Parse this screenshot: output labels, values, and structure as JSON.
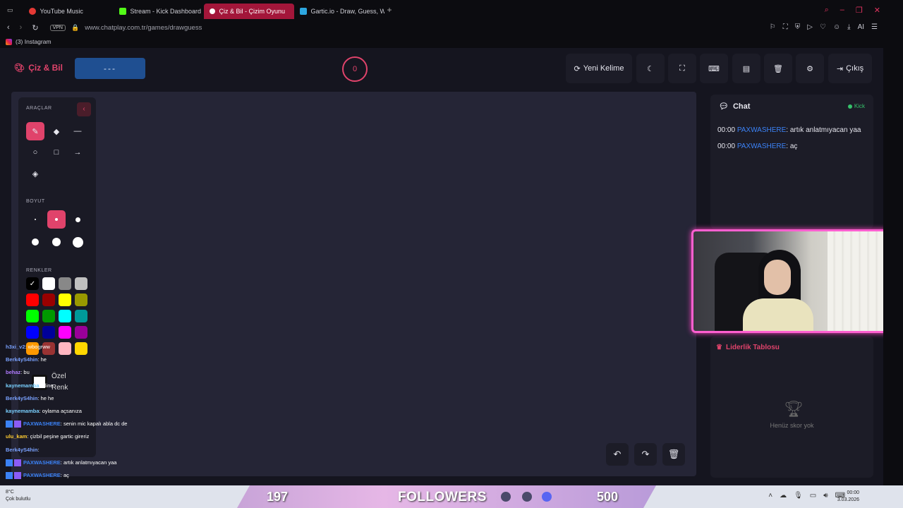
{
  "browser": {
    "tabs": [
      {
        "label": "YouTube Music",
        "color": "#e53935"
      },
      {
        "label": "Stream - Kick Dashboard",
        "color": "#53fc18"
      },
      {
        "label": "Çiz & Bil - Çizim Oyunu",
        "color": "#e0436b"
      },
      {
        "label": "Gartic.io - Draw, Guess, W",
        "color": "#2da7e0"
      }
    ],
    "url": "www.chatplay.com.tr/games/drawguess",
    "vpn": "VPN",
    "bookmark": "(3) Instagram"
  },
  "header": {
    "logo": "Çiz & Bil",
    "word": "---",
    "timer": "0",
    "new_word": "Yeni Kelime",
    "exit": "Çıkış"
  },
  "tools": {
    "title": "ARAÇLAR",
    "size_title": "BOYUT",
    "colors_title": "RENKLER",
    "custom_label": "Özel Renk",
    "swatches": [
      "#000000",
      "#ffffff",
      "#888888",
      "#c0c0c0",
      "#ff0000",
      "#990000",
      "#ffff00",
      "#999900",
      "#00ff00",
      "#009900",
      "#00ffff",
      "#009999",
      "#0000ff",
      "#000099",
      "#ff00ff",
      "#990099",
      "#ff9900",
      "#993333",
      "#ffb6c1",
      "#ffd700"
    ]
  },
  "chat": {
    "title": "Chat",
    "platform": "Kick",
    "messages": [
      {
        "time": "00:00",
        "user": "PAXWASHERE",
        "text": ": artık anlatmıyacan yaa"
      },
      {
        "time": "00:00",
        "user": "PAXWASHERE",
        "text": ": aç"
      }
    ]
  },
  "leaderboard": {
    "title": "Liderlik Tablosu",
    "empty": "Henüz skor yok"
  },
  "overlay_chat": [
    {
      "user": "h3xi_v2",
      "text": ": wbogrww",
      "color": "#7aa2ff",
      "badges": false
    },
    {
      "user": "Berk4yS4hin",
      "text": ": he",
      "color": "#7aa2ff",
      "badges": false
    },
    {
      "user": "behaz",
      "text": ": bu",
      "color": "#b07aff",
      "badges": false
    },
    {
      "user": "kaynemamba",
      "text": ": eline",
      "color": "#7ad0ff",
      "badges": false
    },
    {
      "user": "Berk4yS4hin",
      "text": ": he he",
      "color": "#7aa2ff",
      "badges": false
    },
    {
      "user": "kaynemamba",
      "text": ": oylama açsanıza",
      "color": "#7ad0ff",
      "badges": false
    },
    {
      "user": "PAXWASHERE",
      "text": ": senin mic kapalı abla dc de",
      "color": "#3b82f6",
      "badges": true
    },
    {
      "user": "ulu_kam",
      "text": ": çizbil peşine gartic gireriz",
      "color": "#ffcc33",
      "badges": false
    },
    {
      "user": "Berk4yS4hin",
      "text": ":",
      "color": "#7aa2ff",
      "badges": false
    },
    {
      "user": "PAXWASHERE",
      "text": ": artık anlatmıyacan yaa",
      "color": "#3b82f6",
      "badges": true
    },
    {
      "user": "PAXWASHERE",
      "text": ": aç",
      "color": "#3b82f6",
      "badges": true
    }
  ],
  "taskbar": {
    "temp": "8°C",
    "weather": "Çok bulutlu",
    "time": "00:00",
    "date": "3.03.2026"
  },
  "followers_bar": {
    "current": "197",
    "label": "FOLLOWERS",
    "goal": "500"
  }
}
